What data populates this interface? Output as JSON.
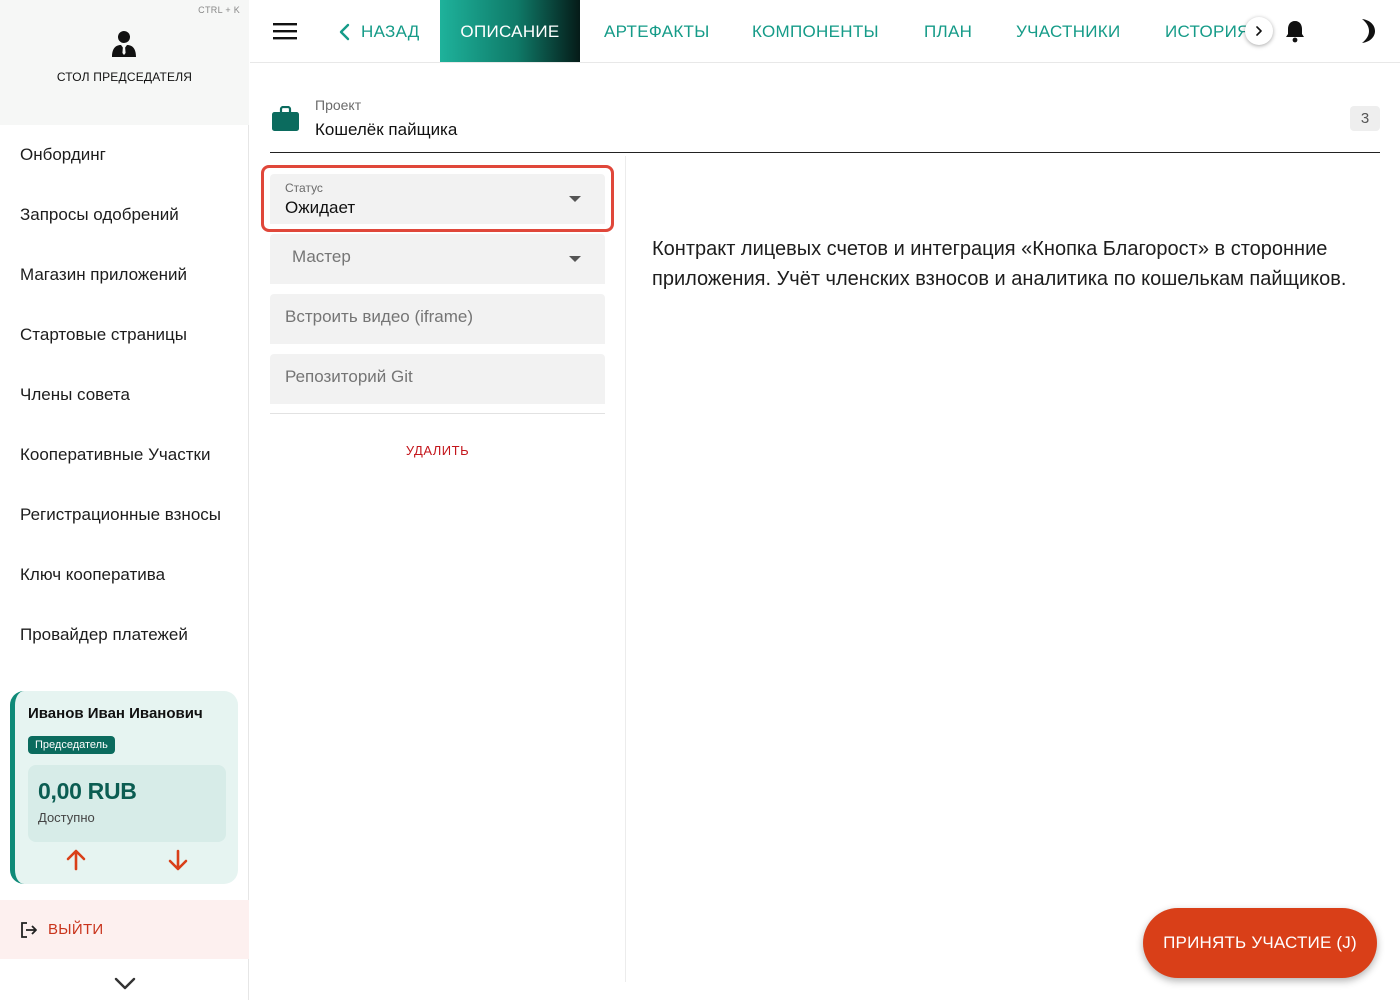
{
  "sidebar": {
    "hotkey": "CTRL + K",
    "title": "СТОЛ ПРЕДСЕДАТЕЛЯ",
    "items": [
      {
        "label": "Онбординг"
      },
      {
        "label": "Запросы одобрений"
      },
      {
        "label": "Магазин приложений"
      },
      {
        "label": "Стартовые страницы"
      },
      {
        "label": "Члены совета"
      },
      {
        "label": "Кооперативные Участки"
      },
      {
        "label": "Регистрационные взносы"
      },
      {
        "label": "Ключ кооператива"
      },
      {
        "label": "Провайдер платежей"
      }
    ],
    "user": {
      "name": "Иванов Иван Иванович",
      "role": "Председатель",
      "balance": "0,00 RUB",
      "balance_caption": "Доступно"
    },
    "logout_label": "ВЫЙТИ"
  },
  "header": {
    "back_label": "НАЗАД",
    "tabs": [
      {
        "label": "ОПИСАНИЕ",
        "active": true
      },
      {
        "label": "АРТЕФАКТЫ"
      },
      {
        "label": "КОМПОНЕНТЫ"
      },
      {
        "label": "ПЛАН"
      },
      {
        "label": "УЧАСТНИКИ"
      },
      {
        "label": "ИСТОРИЯ"
      }
    ]
  },
  "project": {
    "label": "Проект",
    "name": "Кошелёк пайщика",
    "count": "3"
  },
  "form": {
    "status": {
      "label": "Статус",
      "value": "Ожидает"
    },
    "master": {
      "placeholder": "Мастер"
    },
    "video": {
      "placeholder": "Встроить видео (iframe)"
    },
    "git": {
      "placeholder": "Репозиторий Git"
    },
    "delete_label": "УДАЛИТЬ"
  },
  "description": "Контракт лицевых счетов и интеграция «Кнопка Благорост» в сторонние приложения. Учёт членских взносов и аналитика по кошелькам пайщиков.",
  "fab_label": "ПРИНЯТЬ УЧАСТИЕ (J)",
  "colors": {
    "accent": "#159b88",
    "accent_dark": "#0b6b5e",
    "danger": "#d93f18",
    "highlight": "#e0473a"
  },
  "icons": {
    "user": "user-tie-icon",
    "menu": "hamburger-icon",
    "back": "chevron-left-icon",
    "scroll": "chevron-right-icon",
    "bell": "bell-icon",
    "theme": "moon-icon",
    "project": "briefcase-icon",
    "send": "arrow-up-icon",
    "receive": "arrow-down-icon",
    "logout": "logout-icon",
    "collapse": "chevron-down-icon"
  }
}
